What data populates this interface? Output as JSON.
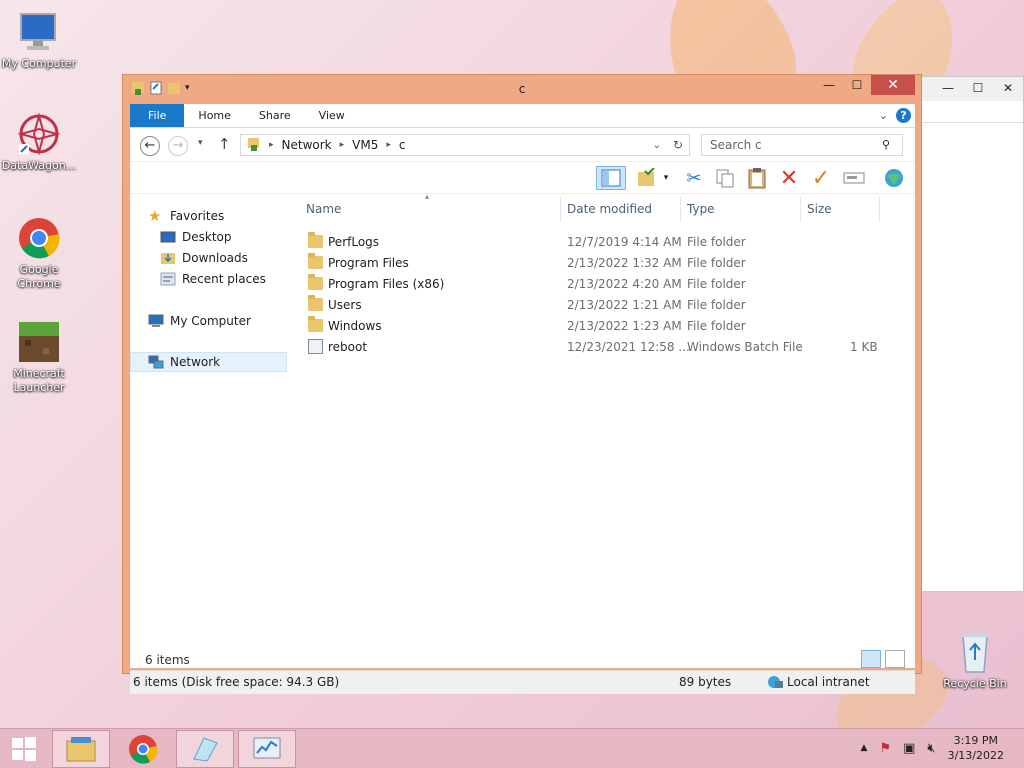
{
  "desktop": {
    "icons": [
      {
        "label": "My Computer"
      },
      {
        "label": "DataWagon..."
      },
      {
        "label": "Google Chrome"
      },
      {
        "label": "Minecraft Launcher"
      },
      {
        "label": "Recycle Bin"
      }
    ]
  },
  "window": {
    "title": "c",
    "ribbon_tabs": [
      "File",
      "Home",
      "Share",
      "View"
    ],
    "address": {
      "crumbs": [
        "Network",
        "VM5",
        "c"
      ]
    },
    "search": {
      "placeholder": "Search c"
    },
    "nav": {
      "favorites": "Favorites",
      "desktop": "Desktop",
      "downloads": "Downloads",
      "recent": "Recent places",
      "computer": "My Computer",
      "network": "Network"
    },
    "columns": {
      "name": "Name",
      "date": "Date modified",
      "type": "Type",
      "size": "Size"
    },
    "files": [
      {
        "name": "PerfLogs",
        "date": "12/7/2019 4:14 AM",
        "type": "File folder",
        "size": ""
      },
      {
        "name": "Program Files",
        "date": "2/13/2022 1:32 AM",
        "type": "File folder",
        "size": ""
      },
      {
        "name": "Program Files (x86)",
        "date": "2/13/2022 4:20 AM",
        "type": "File folder",
        "size": ""
      },
      {
        "name": "Users",
        "date": "2/13/2022 1:21 AM",
        "type": "File folder",
        "size": ""
      },
      {
        "name": "Windows",
        "date": "2/13/2022 1:23 AM",
        "type": "File folder",
        "size": ""
      },
      {
        "name": "reboot",
        "date": "12/23/2021 12:58 ...",
        "type": "Windows Batch File",
        "size": "1 KB"
      }
    ],
    "item_count": "6 items",
    "status": {
      "left": "6 items (Disk free space: 94.3 GB)",
      "middle": "89 bytes",
      "zone": "Local intranet"
    }
  },
  "taskbar": {
    "time": "3:19 PM",
    "date": "3/13/2022"
  },
  "colors": {
    "accent": "#1979ca",
    "window_frame": "#f0a985",
    "close": "#c7504b"
  }
}
